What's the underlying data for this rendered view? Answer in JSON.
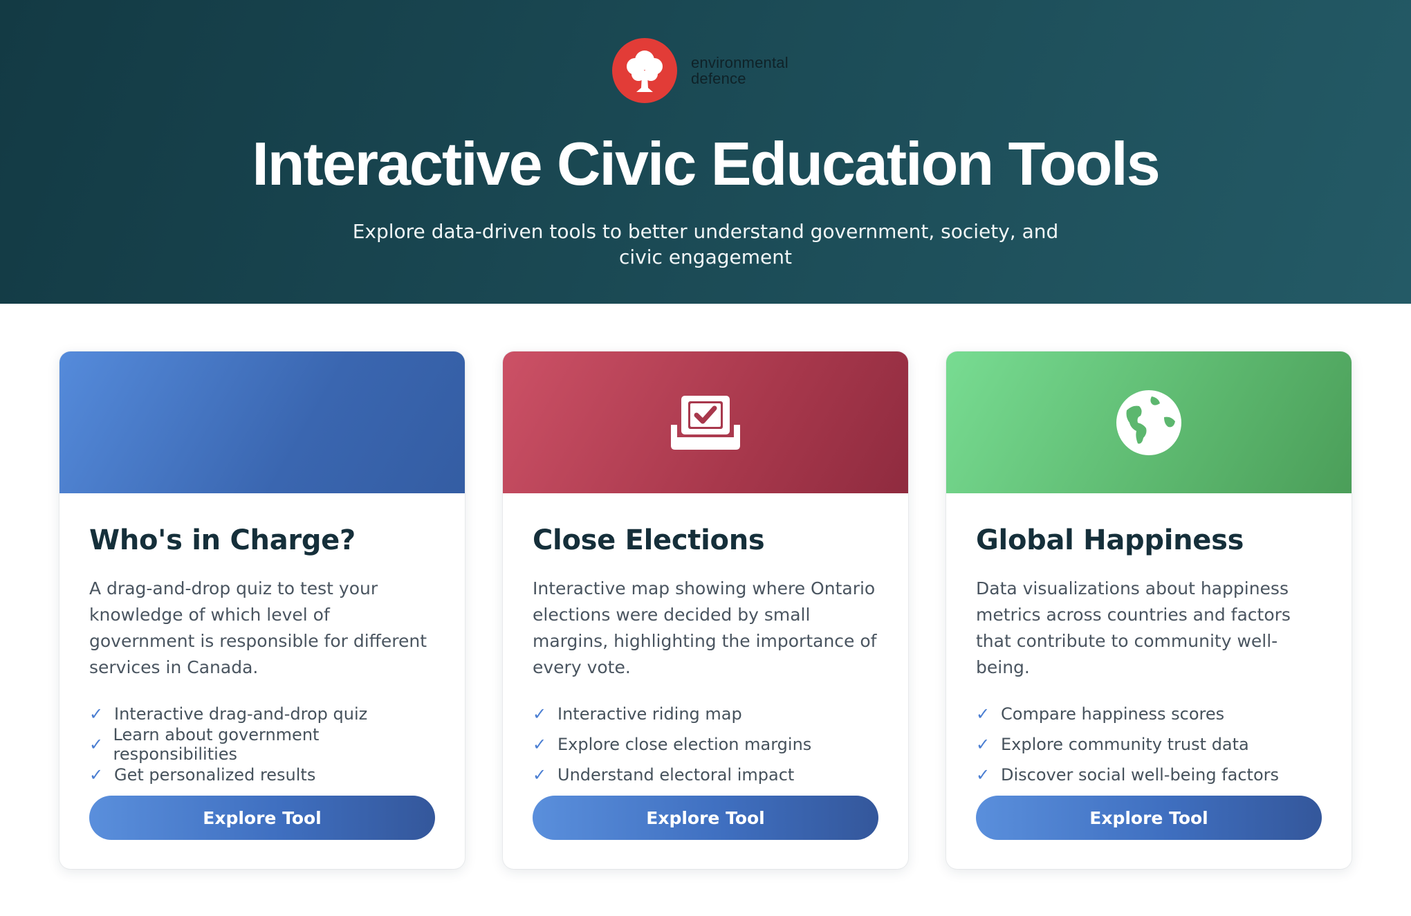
{
  "brand": {
    "line1": "environmental",
    "line2": "defence",
    "logo_icon": "tree-icon",
    "logo_color": "#e23c37"
  },
  "hero": {
    "title": "Interactive Civic Education Tools",
    "subtitle": "Explore data-driven tools to better understand government, society, and civic engagement"
  },
  "cards": [
    {
      "title": "Who's in Charge?",
      "description": "A drag-and-drop quiz to test your knowledge of which level of government is responsible for different services in Canada.",
      "features": [
        "Interactive drag-and-drop quiz",
        "Learn about government responsibilities",
        "Get personalized results"
      ],
      "button": "Explore Tool",
      "color": "#4a7ed2"
    },
    {
      "title": "Close Elections",
      "description": "Interactive map showing where Ontario elections were decided by small margins, highlighting the importance of every vote.",
      "features": [
        "Interactive riding map",
        "Explore close election margins",
        "Understand electoral impact"
      ],
      "button": "Explore Tool",
      "icon": "ballot-box-icon",
      "color": "#b0404f"
    },
    {
      "title": "Global Happiness",
      "description": "Data visualizations about happiness metrics across countries and factors that contribute to community well-being.",
      "features": [
        "Compare happiness scores",
        "Explore community trust data",
        "Discover social well-being factors"
      ],
      "button": "Explore Tool",
      "icon": "globe-icon",
      "color": "#5cb76e"
    }
  ]
}
